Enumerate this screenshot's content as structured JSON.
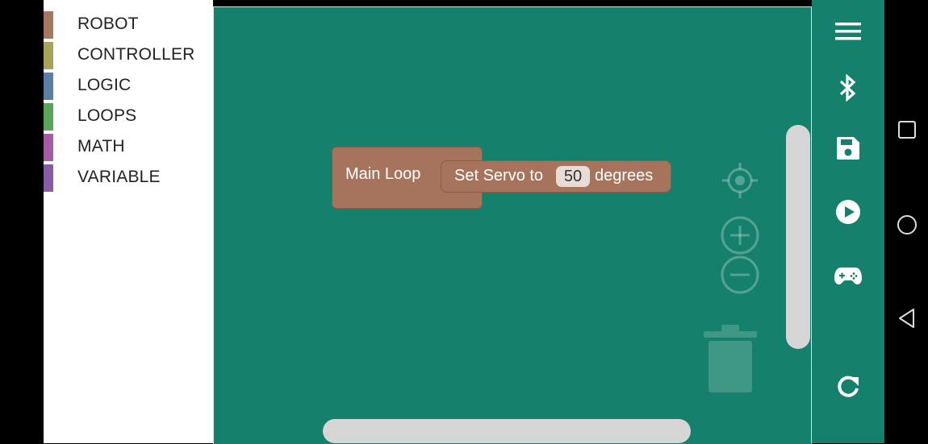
{
  "toolbox": {
    "categories": [
      {
        "label": "ROBOT",
        "color": "#a6775d"
      },
      {
        "label": "CONTROLLER",
        "color": "#a6a35a"
      },
      {
        "label": "LOGIC",
        "color": "#5b80a5"
      },
      {
        "label": "LOOPS",
        "color": "#5ba55b"
      },
      {
        "label": "MATH",
        "color": "#a55ba5"
      },
      {
        "label": "VARIABLE",
        "color": "#8a5ba5"
      }
    ]
  },
  "workspace": {
    "background_color": "#15806b",
    "main_loop_block": {
      "label": "Main Loop",
      "color": "#a6745c"
    },
    "servo_block": {
      "prefix": "Set Servo to",
      "value": "50",
      "suffix": "degrees"
    }
  },
  "workspace_controls": [
    "recenter-icon",
    "zoom-in-icon",
    "zoom-out-icon",
    "trash-icon"
  ],
  "appbar": {
    "icons": [
      "menu-icon",
      "bluetooth-icon",
      "save-icon",
      "play-icon",
      "gamepad-icon",
      "refresh-icon"
    ]
  },
  "system_nav": {
    "icons": [
      "recents-icon",
      "home-icon",
      "back-icon"
    ]
  }
}
